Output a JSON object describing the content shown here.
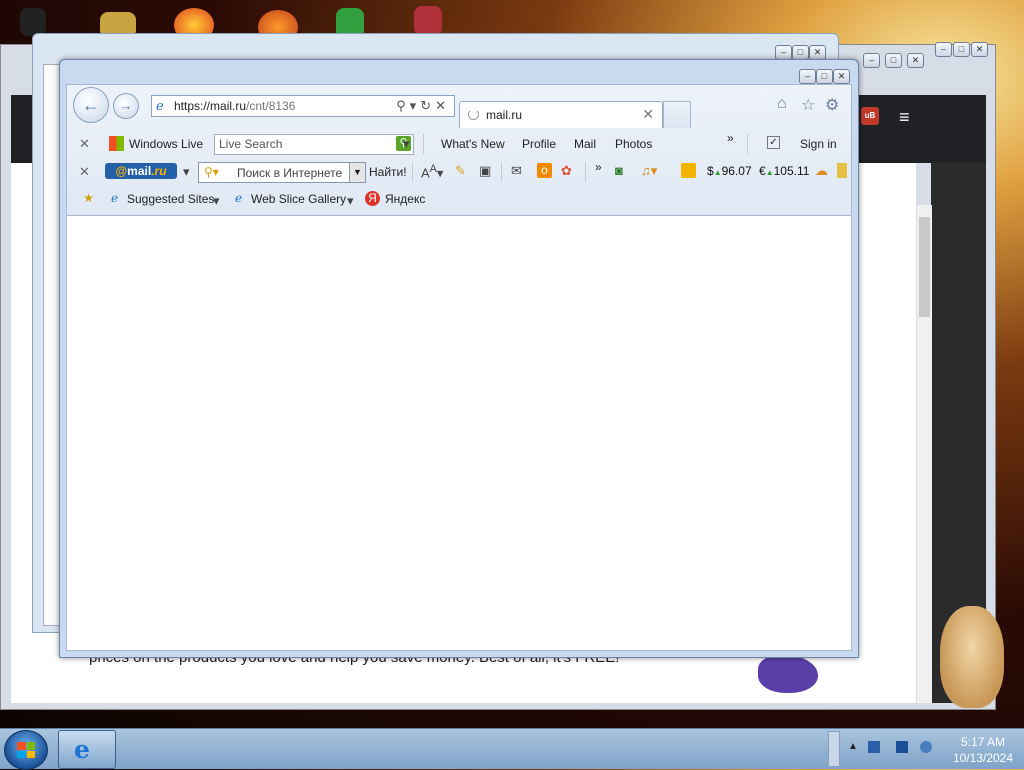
{
  "browser": {
    "address_url_host": "https://mail.ru",
    "address_url_path": "/cnt/8136",
    "tab_label": "mail.ru"
  },
  "windows_live_bar": {
    "brand": "Windows Live",
    "search_placeholder": "Live Search",
    "links": [
      "What's New",
      "Profile",
      "Mail",
      "Photos"
    ],
    "more": "»",
    "sign_in": "Sign in"
  },
  "mailru_bar": {
    "logo_at": "@",
    "logo_mail": "mail",
    "logo_ru": ".ru",
    "search_placeholder": "Поиск в Интернете",
    "find_button": "Найти!",
    "more": "»",
    "usd_symbol": "$",
    "usd_value": "96.07",
    "eur_symbol": "€",
    "eur_value": "105.11"
  },
  "favorites_bar": {
    "items": [
      "Suggested Sites",
      "Web Slice Gallery",
      "Яндекс"
    ]
  },
  "background_page": {
    "text": "prices on the products you love and help you save money. Best of all, it's FREE!"
  },
  "taskbar": {
    "time": "5:17 AM",
    "date": "10/13/2024"
  },
  "colors": {
    "ie_frame": "#c9daf0",
    "mailru_logo": "#2360a8",
    "taskbar": "#8fb0d2"
  }
}
